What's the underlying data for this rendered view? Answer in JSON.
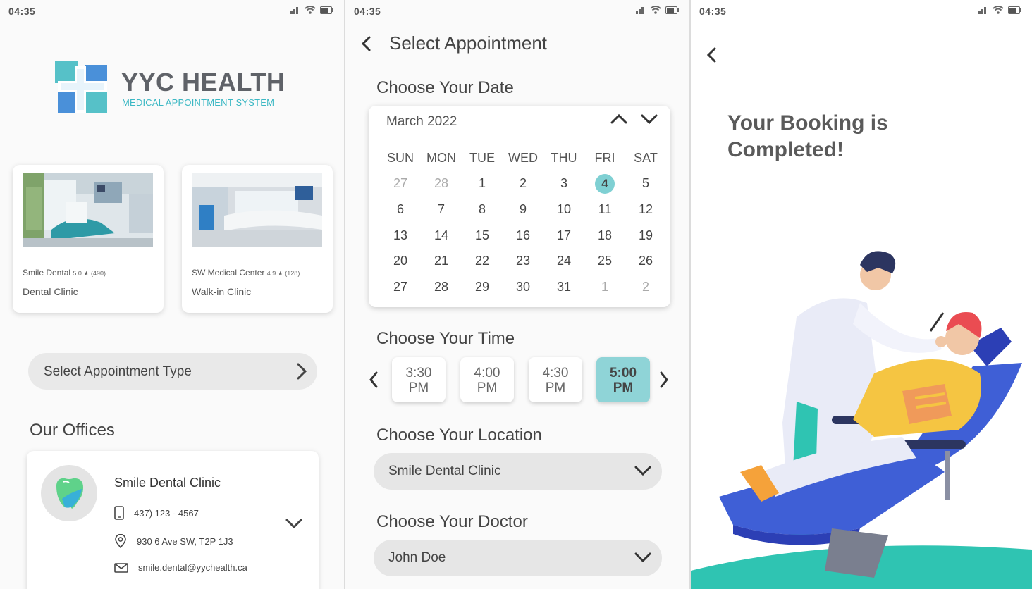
{
  "status_bar": {
    "time": "04:35"
  },
  "screen1": {
    "logo": {
      "title": "YYC HEALTH",
      "subtitle": "MEDICAL APPOINTMENT SYSTEM"
    },
    "clinics": [
      {
        "name": "Smile Dental",
        "rating": "5.0 ★ (490)",
        "type": "Dental Clinic"
      },
      {
        "name": "SW Medical Center",
        "rating": "4.9 ★ (128)",
        "type": "Walk-in Clinic"
      }
    ],
    "select_type_label": "Select Appointment Type",
    "offices_title": "Our Offices",
    "office": {
      "name": "Smile Dental Clinic",
      "phone": "437) 123 - 4567",
      "address": "930 6 Ave SW, T2P 1J3",
      "email": "smile.dental@yychealth.ca"
    }
  },
  "screen2": {
    "title": "Select Appointment",
    "date_section": "Choose Your Date",
    "month": "March 2022",
    "weekdays": [
      "SUN",
      "MON",
      "TUE",
      "WED",
      "THU",
      "FRI",
      "SAT"
    ],
    "weeks": [
      [
        "27",
        "28",
        "1",
        "2",
        "3",
        "4",
        "5"
      ],
      [
        "6",
        "7",
        "8",
        "9",
        "10",
        "11",
        "12"
      ],
      [
        "13",
        "14",
        "15",
        "16",
        "17",
        "18",
        "19"
      ],
      [
        "20",
        "21",
        "22",
        "23",
        "24",
        "25",
        "26"
      ],
      [
        "27",
        "28",
        "29",
        "30",
        "31",
        "1",
        "2"
      ]
    ],
    "selected_day": "4",
    "time_section": "Choose Your Time",
    "time_slots": [
      {
        "time": "3:30",
        "period": "PM"
      },
      {
        "time": "4:00",
        "period": "PM"
      },
      {
        "time": "4:30",
        "period": "PM"
      },
      {
        "time": "5:00",
        "period": "PM"
      }
    ],
    "selected_time": "5:00 PM",
    "location_section": "Choose Your Location",
    "location_value": "Smile Dental Clinic",
    "doctor_section": "Choose Your Doctor",
    "doctor_value": "John Doe"
  },
  "screen3": {
    "message_line1": "Your Booking is",
    "message_line2": "Completed!"
  },
  "colors": {
    "accent_teal": "#7fd0d3",
    "logo_teal": "#3cb8c4",
    "logo_blue": "#4a90d9",
    "chair_blue": "#3f5fd6",
    "patient_yellow": "#f5c542"
  },
  "icons": {
    "status": [
      "signal-icon",
      "wifi-icon",
      "battery-icon"
    ],
    "navigation": [
      "back-arrow-icon",
      "chevron-right-icon",
      "chevron-down-icon",
      "chevron-up-icon",
      "chevron-left-icon"
    ],
    "office": [
      "tooth-icon",
      "phone-icon",
      "location-pin-icon",
      "mail-icon"
    ]
  }
}
